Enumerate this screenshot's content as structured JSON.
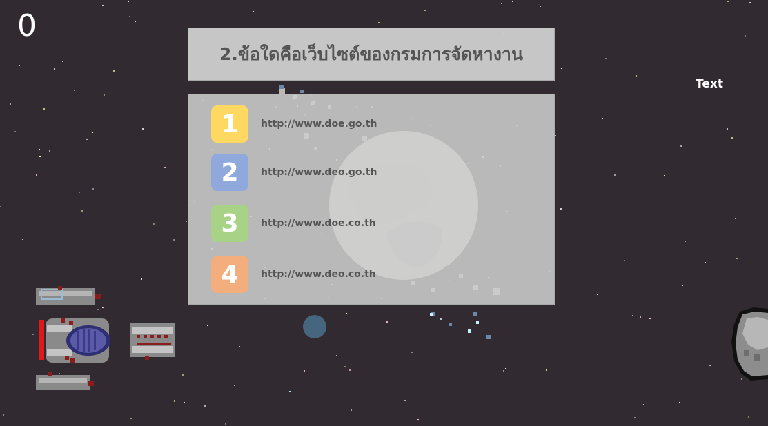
{
  "hud": {
    "score": "0",
    "corner_label": "Text"
  },
  "quiz": {
    "question": "2.ข้อใดคือเว็บไซต์ของกรมการจัดหางาน",
    "answers": [
      {
        "number": "1",
        "text": "http://www.doe.go.th",
        "color": "#ffd862"
      },
      {
        "number": "2",
        "text": "http://www.deo.go.th",
        "color": "#8fa9dd"
      },
      {
        "number": "3",
        "text": "http://www.doe.co.th",
        "color": "#a8d387"
      },
      {
        "number": "4",
        "text": "http://www.deo.co.th",
        "color": "#f4ad7d"
      }
    ]
  },
  "colors": {
    "background": "#322a31",
    "panel": "#cdcdcd",
    "text": "#555555",
    "moon": "#46657f"
  }
}
